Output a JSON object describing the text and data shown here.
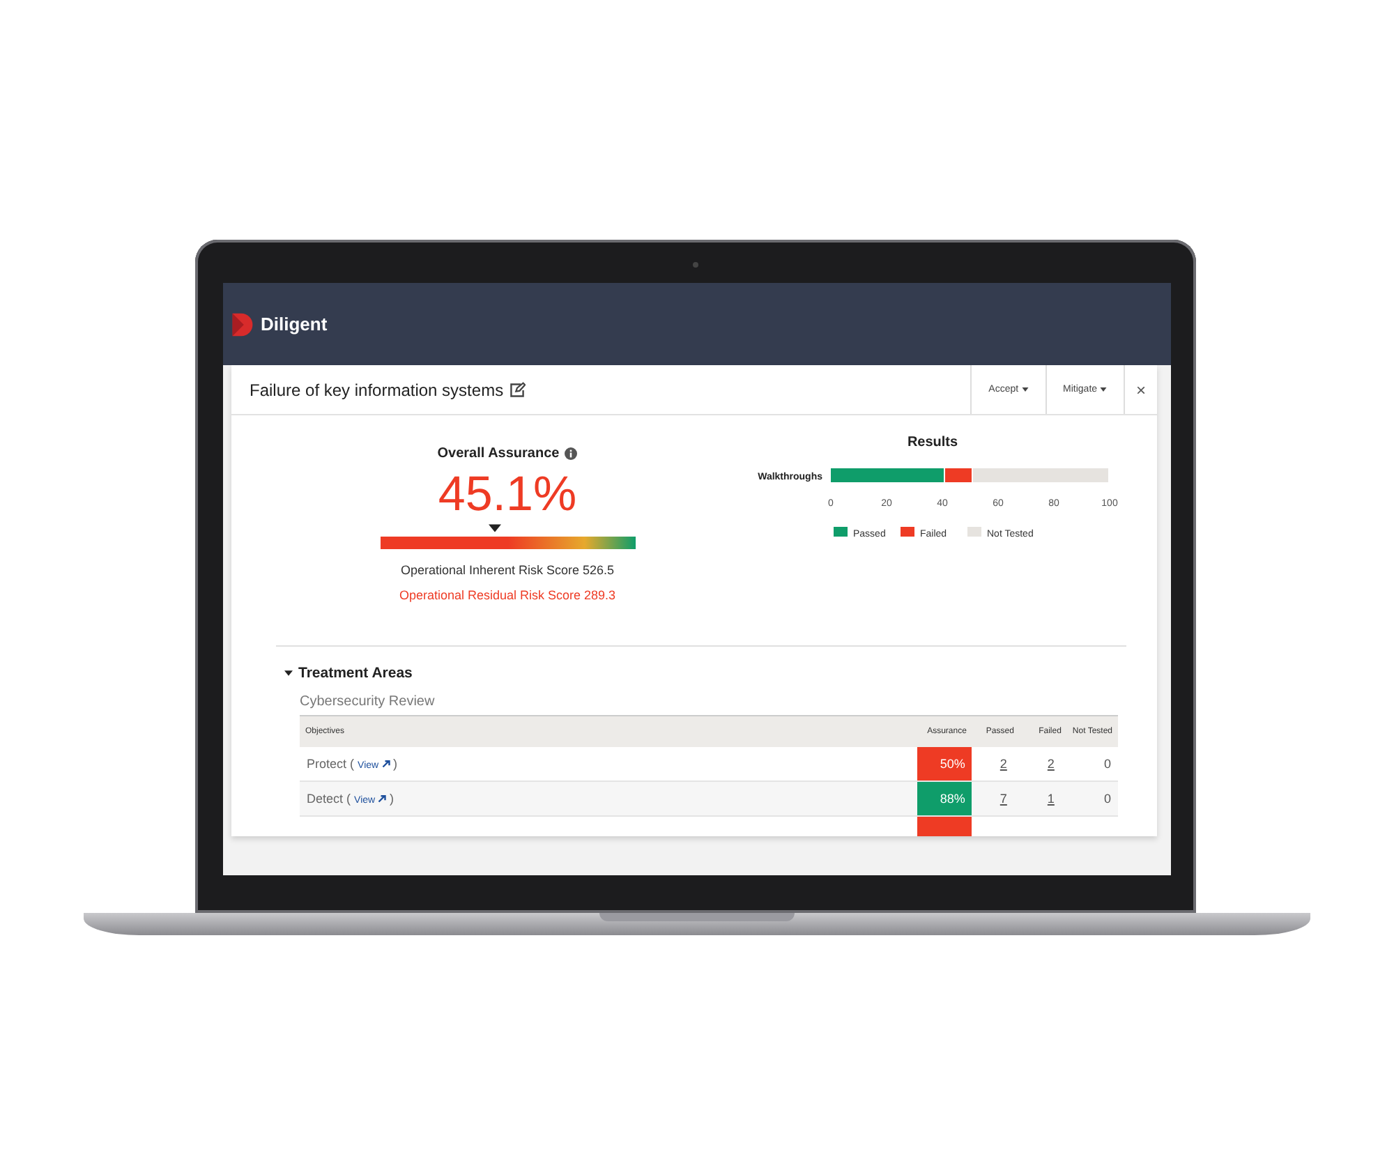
{
  "app": {
    "brand": "Diligent"
  },
  "panel": {
    "title": "Failure of key information systems",
    "actions": [
      {
        "label": "Accept"
      },
      {
        "label": "Mitigate"
      }
    ],
    "close": "×"
  },
  "assurance": {
    "heading": "Overall Assurance",
    "value": "45.1%",
    "level": 0.451,
    "inherent": "Operational Inherent Risk Score 526.5",
    "residual": "Operational Residual Risk Score 289.3"
  },
  "results": {
    "chart_data": {
      "type": "bar",
      "title": "Results",
      "orientation": "horizontal",
      "stacked": true,
      "categories": [
        "Walkthroughs"
      ],
      "series": [
        {
          "name": "Passed",
          "color": "#0f9d6a",
          "values": [
            41
          ]
        },
        {
          "name": "Failed",
          "color": "#ee3b24",
          "values": [
            10
          ]
        },
        {
          "name": "Not Tested",
          "color": "#e6e3df",
          "values": [
            49
          ]
        }
      ],
      "legend": "bottom",
      "xlim": [
        0,
        100
      ],
      "xticks": [
        0,
        20,
        40,
        60,
        80,
        100
      ]
    }
  },
  "treatment": {
    "heading": "Treatment Areas",
    "expanded": true,
    "section": "Cybersecurity Review",
    "columns": [
      "Objectives",
      "Assurance",
      "Passed",
      "Failed",
      "Not Tested"
    ],
    "rows": [
      {
        "objective": "Protect",
        "open": "(",
        "link": "View",
        "close": ")",
        "assurance": "50%",
        "color": "#ee3b24",
        "passed": "2",
        "failed": "2",
        "not_tested": "0"
      },
      {
        "objective": "Detect",
        "open": "(",
        "link": "View",
        "close": ")",
        "assurance": "88%",
        "color": "#0f9d6a",
        "passed": "7",
        "failed": "1",
        "not_tested": "0"
      },
      {
        "kind": "cut",
        "color": "#ee3b24"
      }
    ]
  }
}
